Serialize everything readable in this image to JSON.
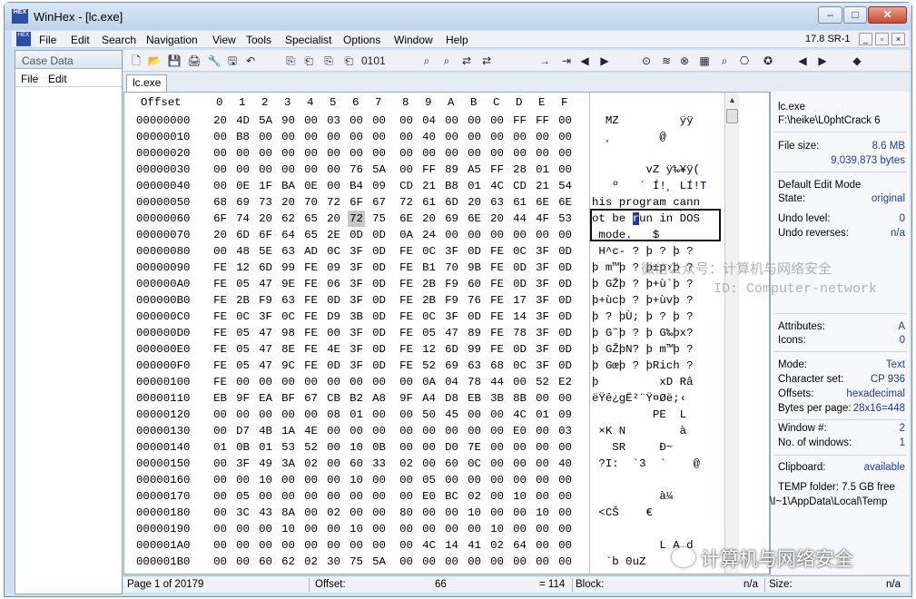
{
  "window": {
    "title": "WinHex - [lc.exe]",
    "logo": "HEX",
    "min": "–",
    "max": "□",
    "close": "✕"
  },
  "menu": {
    "items": [
      "File",
      "Edit",
      "Search",
      "Navigation",
      "View",
      "Tools",
      "Specialist",
      "Options",
      "Window",
      "Help"
    ],
    "version": "17.8 SR-1",
    "mdi": [
      "_",
      "▫",
      "×"
    ]
  },
  "case": {
    "title": "Case Data",
    "menu": [
      "File",
      "Edit"
    ]
  },
  "toolbar_icons": [
    "new-file-icon",
    "open-icon",
    "save-icon",
    "print-icon",
    "properties-icon",
    "open-disk-icon",
    "undo-icon",
    "copy-icon",
    "paste-icon",
    "copy-block-icon",
    "paste-block-icon",
    "hex-icon",
    "binoculars-icon",
    "find-hex-icon",
    "replace-icon",
    "replace-hex-icon",
    "goto-offset-icon",
    "goto-sector-icon",
    "back-icon",
    "forward-icon",
    "disk-icon",
    "hash-icon",
    "wipe-icon",
    "calc-icon",
    "search-icon",
    "compare-icon",
    "bookmark-icon",
    "prev-icon",
    "next-icon",
    "gem-icon"
  ],
  "toolbar_glyphs": [
    "🗋",
    "📂",
    "💾",
    "🖨",
    "🔧",
    "🖫",
    "↶",
    "⎘",
    "⎗",
    "⎘",
    "⎗",
    "0101",
    "⌕",
    "⌕",
    "⇄",
    "⇄",
    "→",
    "⇥",
    "◀",
    "▶",
    "⊙",
    "≋",
    "⊗",
    "▦",
    "⌕",
    "⎔",
    "✪",
    "◀",
    "▶",
    "◆"
  ],
  "tab": {
    "label": "lc.exe"
  },
  "hex": {
    "header_offset": "Offset",
    "columns": [
      "0",
      "1",
      "2",
      "3",
      "4",
      "5",
      "6",
      "7",
      "8",
      "9",
      "A",
      "B",
      "C",
      "D",
      "E",
      "F"
    ],
    "selected": {
      "row": 6,
      "col": 6
    },
    "rows": [
      {
        "offset": "00000000",
        "bytes": [
          "20",
          "4D",
          "5A",
          "90",
          "00",
          "03",
          "00",
          "00",
          "00",
          "04",
          "00",
          "00",
          "00",
          "FF",
          "FF",
          "00"
        ],
        "text": "  MZ         ÿÿ"
      },
      {
        "offset": "00000010",
        "bytes": [
          "00",
          "B8",
          "00",
          "00",
          "00",
          "00",
          "00",
          "00",
          "00",
          "40",
          "00",
          "00",
          "00",
          "00",
          "00",
          "00"
        ],
        "text": "  ¸       @"
      },
      {
        "offset": "00000020",
        "bytes": [
          "00",
          "00",
          "00",
          "00",
          "00",
          "00",
          "00",
          "00",
          "00",
          "00",
          "00",
          "00",
          "00",
          "00",
          "00",
          "00"
        ],
        "text": ""
      },
      {
        "offset": "00000030",
        "bytes": [
          "00",
          "00",
          "00",
          "00",
          "00",
          "00",
          "76",
          "5A",
          "00",
          "FF",
          "89",
          "A5",
          "FF",
          "28",
          "01",
          "00"
        ],
        "text": "        vZ ÿ‰¥ÿ("
      },
      {
        "offset": "00000040",
        "bytes": [
          "00",
          "0E",
          "1F",
          "BA",
          "0E",
          "00",
          "B4",
          "09",
          "CD",
          "21",
          "B8",
          "01",
          "4C",
          "CD",
          "21",
          "54"
        ],
        "text": "   º   ´ Í!¸ LÍ!T"
      },
      {
        "offset": "00000050",
        "bytes": [
          "68",
          "69",
          "73",
          "20",
          "70",
          "72",
          "6F",
          "67",
          "72",
          "61",
          "6D",
          "20",
          "63",
          "61",
          "6E",
          "6E"
        ],
        "text": "his program cann"
      },
      {
        "offset": "00000060",
        "bytes": [
          "6F",
          "74",
          "20",
          "62",
          "65",
          "20",
          "72",
          "75",
          "6E",
          "20",
          "69",
          "6E",
          "20",
          "44",
          "4F",
          "53"
        ],
        "text": "ot be run in DOS"
      },
      {
        "offset": "00000070",
        "bytes": [
          "20",
          "6D",
          "6F",
          "64",
          "65",
          "2E",
          "0D",
          "0D",
          "0A",
          "24",
          "00",
          "00",
          "00",
          "00",
          "00",
          "00"
        ],
        "text": " mode.   $"
      },
      {
        "offset": "00000080",
        "bytes": [
          "00",
          "48",
          "5E",
          "63",
          "AD",
          "0C",
          "3F",
          "0D",
          "FE",
          "0C",
          "3F",
          "0D",
          "FE",
          "0C",
          "3F",
          "0D"
        ],
        "text": " H^c- ? þ ? þ ?"
      },
      {
        "offset": "00000090",
        "bytes": [
          "FE",
          "12",
          "6D",
          "99",
          "FE",
          "09",
          "3F",
          "0D",
          "FE",
          "B1",
          "70",
          "9B",
          "FE",
          "0D",
          "3F",
          "0D"
        ],
        "text": "þ m™þ ? þ±p›þ ?"
      },
      {
        "offset": "000000A0",
        "bytes": [
          "FE",
          "05",
          "47",
          "9E",
          "FE",
          "06",
          "3F",
          "0D",
          "FE",
          "2B",
          "F9",
          "60",
          "FE",
          "0D",
          "3F",
          "0D"
        ],
        "text": "þ GŽþ ? þ+ù`þ ?"
      },
      {
        "offset": "000000B0",
        "bytes": [
          "FE",
          "2B",
          "F9",
          "63",
          "FE",
          "0D",
          "3F",
          "0D",
          "FE",
          "2B",
          "F9",
          "76",
          "FE",
          "17",
          "3F",
          "0D"
        ],
        "text": "þ+ùcþ ? þ+ùvþ ?"
      },
      {
        "offset": "000000C0",
        "bytes": [
          "FE",
          "0C",
          "3F",
          "0C",
          "FE",
          "D9",
          "3B",
          "0D",
          "FE",
          "0C",
          "3F",
          "0D",
          "FE",
          "14",
          "3F",
          "0D"
        ],
        "text": "þ ? þÙ; þ ? þ ?"
      },
      {
        "offset": "000000D0",
        "bytes": [
          "FE",
          "05",
          "47",
          "98",
          "FE",
          "00",
          "3F",
          "0D",
          "FE",
          "05",
          "47",
          "89",
          "FE",
          "78",
          "3F",
          "0D"
        ],
        "text": "þ G˜þ ? þ G‰þx?"
      },
      {
        "offset": "000000E0",
        "bytes": [
          "FE",
          "05",
          "47",
          "8E",
          "FE",
          "4E",
          "3F",
          "0D",
          "FE",
          "12",
          "6D",
          "99",
          "FE",
          "0D",
          "3F",
          "0D"
        ],
        "text": "þ GŽþN? þ m™þ ?"
      },
      {
        "offset": "000000F0",
        "bytes": [
          "FE",
          "05",
          "47",
          "9C",
          "FE",
          "0D",
          "3F",
          "0D",
          "FE",
          "52",
          "69",
          "63",
          "68",
          "0C",
          "3F",
          "0D"
        ],
        "text": "þ Gœþ ? þRich ?"
      },
      {
        "offset": "00000100",
        "bytes": [
          "FE",
          "00",
          "00",
          "00",
          "00",
          "00",
          "00",
          "00",
          "00",
          "0A",
          "04",
          "78",
          "44",
          "00",
          "52",
          "E2"
        ],
        "text": "þ         xD Râ"
      },
      {
        "offset": "00000110",
        "bytes": [
          "EB",
          "9F",
          "EA",
          "BF",
          "67",
          "CB",
          "B2",
          "A8",
          "9F",
          "A4",
          "D8",
          "EB",
          "3B",
          "8B",
          "00",
          "00"
        ],
        "text": "ëŸê¿gË²¨Ÿ¤Øë;‹"
      },
      {
        "offset": "00000120",
        "bytes": [
          "00",
          "00",
          "00",
          "00",
          "00",
          "08",
          "01",
          "00",
          "00",
          "50",
          "45",
          "00",
          "00",
          "4C",
          "01",
          "09"
        ],
        "text": "         PE  L"
      },
      {
        "offset": "00000130",
        "bytes": [
          "00",
          "D7",
          "4B",
          "1A",
          "4E",
          "00",
          "00",
          "00",
          "00",
          "00",
          "00",
          "00",
          "00",
          "E0",
          "00",
          "03"
        ],
        "text": " ×K N        à"
      },
      {
        "offset": "00000140",
        "bytes": [
          "01",
          "0B",
          "01",
          "53",
          "52",
          "00",
          "10",
          "0B",
          "00",
          "00",
          "D0",
          "7E",
          "00",
          "00",
          "00",
          "00"
        ],
        "text": "   SR     Ð~"
      },
      {
        "offset": "00000150",
        "bytes": [
          "00",
          "3F",
          "49",
          "3A",
          "02",
          "00",
          "60",
          "33",
          "02",
          "00",
          "60",
          "0C",
          "00",
          "00",
          "00",
          "40"
        ],
        "text": " ?I:  `3  `    @"
      },
      {
        "offset": "00000160",
        "bytes": [
          "00",
          "00",
          "10",
          "00",
          "00",
          "00",
          "10",
          "00",
          "00",
          "05",
          "00",
          "00",
          "00",
          "00",
          "00",
          "00"
        ],
        "text": ""
      },
      {
        "offset": "00000170",
        "bytes": [
          "00",
          "05",
          "00",
          "00",
          "00",
          "00",
          "00",
          "00",
          "00",
          "E0",
          "BC",
          "02",
          "00",
          "10",
          "00",
          "00"
        ],
        "text": "          à¼"
      },
      {
        "offset": "00000180",
        "bytes": [
          "00",
          "3C",
          "43",
          "8A",
          "00",
          "02",
          "00",
          "00",
          "80",
          "00",
          "00",
          "10",
          "00",
          "00",
          "10",
          "00"
        ],
        "text": " <CŠ    €"
      },
      {
        "offset": "00000190",
        "bytes": [
          "00",
          "00",
          "00",
          "10",
          "00",
          "00",
          "10",
          "00",
          "00",
          "00",
          "00",
          "00",
          "10",
          "00",
          "00",
          "00"
        ],
        "text": ""
      },
      {
        "offset": "000001A0",
        "bytes": [
          "00",
          "00",
          "00",
          "00",
          "00",
          "00",
          "00",
          "00",
          "00",
          "4C",
          "14",
          "41",
          "02",
          "64",
          "00",
          "00"
        ],
        "text": "          L A d"
      },
      {
        "offset": "000001B0",
        "bytes": [
          "00",
          "00",
          "60",
          "62",
          "02",
          "30",
          "75",
          "5A",
          "00",
          "00",
          "00",
          "00",
          "00",
          "00",
          "00",
          "00"
        ],
        "text": "  `b 0uZ"
      }
    ]
  },
  "info": {
    "filename": "lc.exe",
    "path": "F:\\heike\\L0phtCrack 6",
    "file_size_label": "File size:",
    "file_size": "8.6 MB",
    "file_size_bytes": "9,039,873 bytes",
    "edit_mode": "Default Edit Mode",
    "state_label": "State:",
    "state": "original",
    "undo_level_label": "Undo level:",
    "undo_level": "0",
    "undo_reverses_label": "Undo reverses:",
    "undo_reverses": "n/a",
    "attributes_label": "Attributes:",
    "attributes": "A",
    "icons_label": "Icons:",
    "icons": "0",
    "mode_label": "Mode:",
    "mode": "Text",
    "charset_label": "Character set:",
    "charset": "CP 936",
    "offsets_label": "Offsets:",
    "offsets": "hexadecimal",
    "bpp_label": "Bytes per page:",
    "bpp": "28x16=448",
    "window_no_label": "Window #:",
    "window_no": "2",
    "windows_label": "No. of windows:",
    "windows": "1",
    "clipboard_label": "Clipboard:",
    "clipboard": "available",
    "temp_label": "TEMP folder: 7.5 GB free",
    "temp_path": "\\I~1\\AppData\\Local\\Temp"
  },
  "status": {
    "page": "Page 1 of 20179",
    "offset_label": "Offset:",
    "offset_value": "66",
    "eq": "= 114",
    "block_label": "Block:",
    "block_value": "n/a",
    "size_label": "Size:",
    "size_value": "n/a"
  },
  "watermark": {
    "line1": "微信公众号：计算机与网络安全",
    "line2": "ID: Computer-network",
    "line3": "计算机与网络安全"
  }
}
